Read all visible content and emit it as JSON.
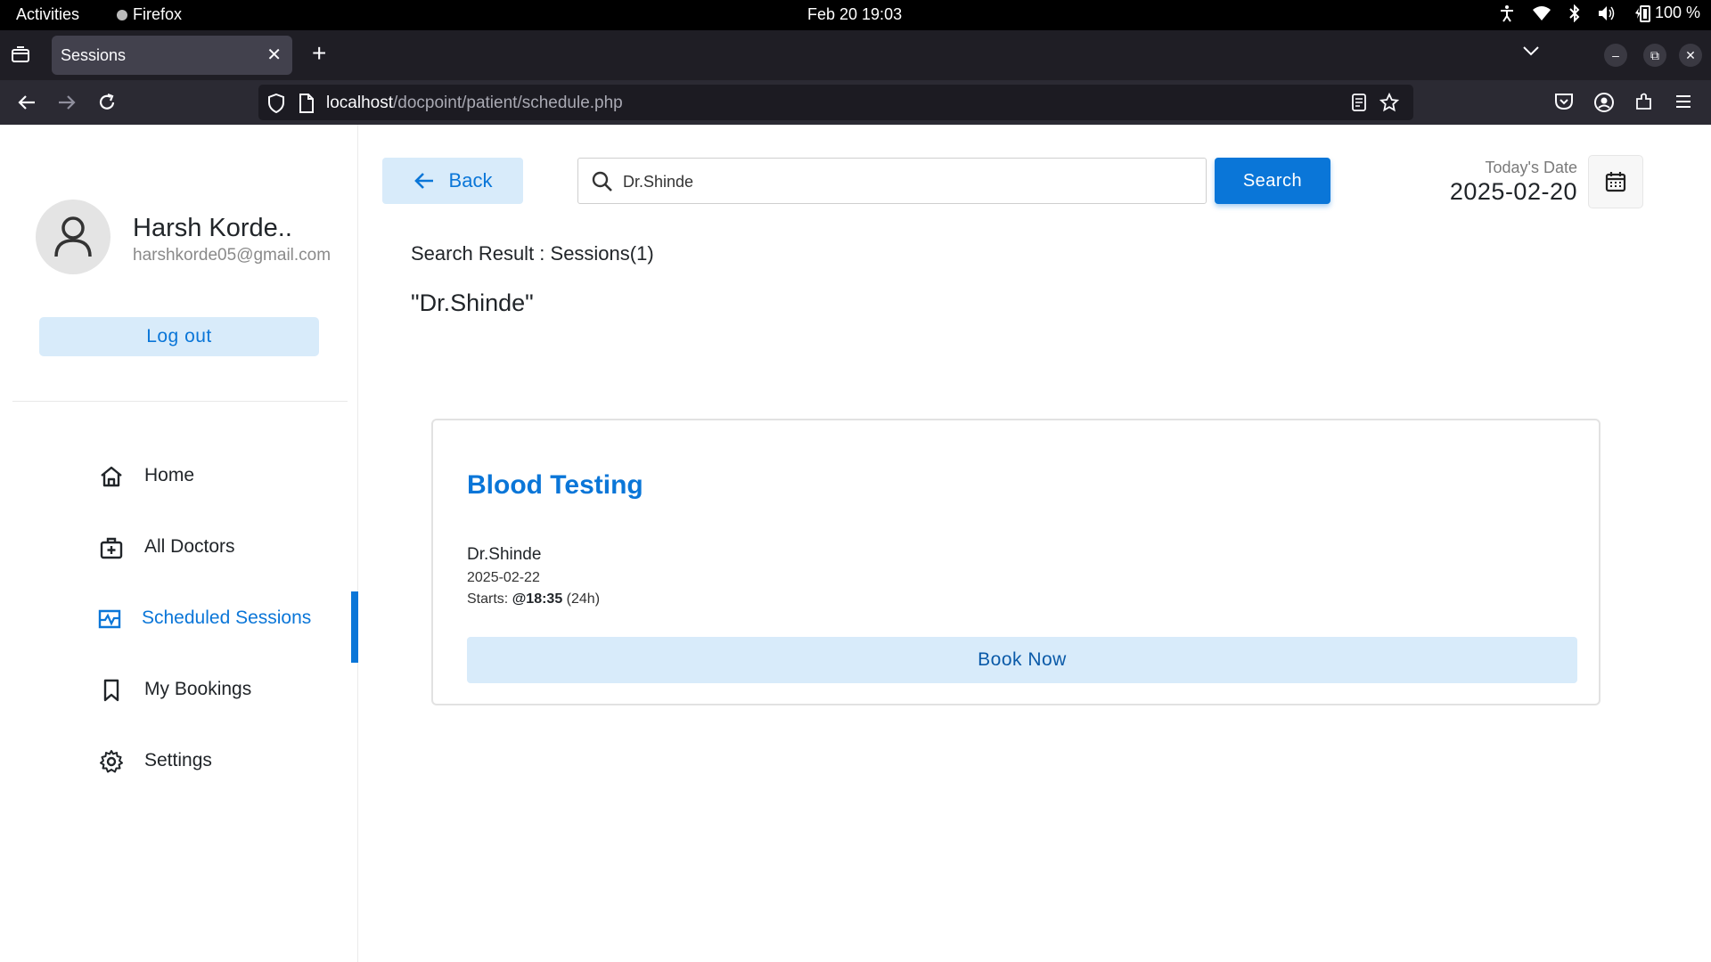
{
  "system_bar": {
    "activities": "Activities",
    "app": "Firefox",
    "clock": "Feb 20  19:03",
    "battery": "100 %"
  },
  "browser": {
    "tab_title": "Sessions",
    "url_host": "localhost",
    "url_path": "/docpoint/patient/schedule.php"
  },
  "profile": {
    "name": "Harsh Korde..",
    "email": "harshkorde05@gmail.com",
    "logout_label": "Log out"
  },
  "sidebar": {
    "items": [
      {
        "label": "Home",
        "icon": "home-icon"
      },
      {
        "label": "All Doctors",
        "icon": "doctor-bag-icon"
      },
      {
        "label": "Scheduled Sessions",
        "icon": "schedule-icon"
      },
      {
        "label": "My Bookings",
        "icon": "bookmark-icon"
      },
      {
        "label": "Settings",
        "icon": "gear-icon"
      }
    ],
    "active_index": 2
  },
  "header": {
    "back_label": "Back",
    "search_value": "Dr.Shinde",
    "search_button": "Search",
    "date_label": "Today's Date",
    "date_value": "2025-02-20"
  },
  "results": {
    "heading": "Search Result : Sessions(1)",
    "query": "\"Dr.Shinde\"",
    "sessions": [
      {
        "title": "Blood Testing",
        "doctor": "Dr.Shinde",
        "date": "2025-02-22",
        "starts_prefix": "Starts: ",
        "start_time": "@18:35",
        "time_suffix": " (24h)",
        "book_label": "Book Now"
      }
    ]
  },
  "colors": {
    "accent": "#0a76d8",
    "accent_light": "#d8ebfa"
  }
}
